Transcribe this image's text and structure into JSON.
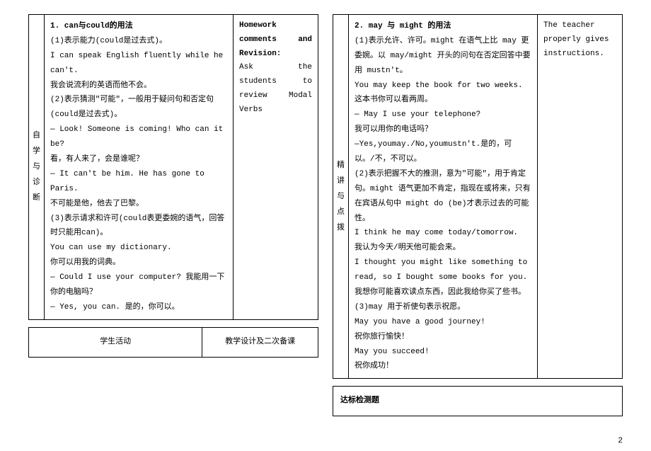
{
  "left": {
    "vlabel": [
      "自",
      "学",
      "与",
      "诊",
      "断"
    ],
    "heading": "1. can与could的用法",
    "lines": [
      "(1)表示能力(could是过去式)。",
      "I can speak English fluently while he can't.",
      "我会说流利的英语而他不会。",
      "(2)表示猜测\"可能\"，一般用于疑问句和否定句(could是过去式)。",
      "— Look! Someone is coming! Who can it be?",
      "看，有人来了，会是谁呢？",
      "— It can't be him. He has gone to Paris.",
      "不可能是他，他去了巴黎。",
      "(3)表示请求和许可(could表更委婉的语气，回答时只能用can)。",
      "You can use my dictionary.",
      "你可以用我的词典。",
      "— Could I use your computer?  我能用一下你的电脑吗？",
      "— Yes, you can. 是的，你可以。"
    ],
    "notes_heading": "Homework comments and Revision:",
    "notes_body": "Ask the students to review Modal Verbs",
    "bottom_left": "学生活动",
    "bottom_right": "教学设计及二次备课"
  },
  "right": {
    "vlabel": [
      "精",
      "讲",
      "与",
      "点",
      "拨"
    ],
    "heading": "2. may 与 might 的用法",
    "lines": [
      "(1)表示允许、许可。might 在语气上比 may 更委婉。以 may/might 开头的问句在否定回答中要用 mustn't。",
      "You may keep the book for two weeks.",
      "这本书你可以看两周。",
      "— May I use your telephone?",
      "我可以用你的电话吗？",
      "—Yes,youmay./No,youmustn't.是的，可以。/不，不可以。",
      "(2)表示把握不大的推测，意为\"可能\"，用于肯定句。might 语气更加不肯定，指现在或将来，只有在宾语从句中 might do (be)才表示过去的可能性。",
      "I think he may come today/tomorrow.",
      "我认为今天/明天他可能会来。",
      "I thought you might like something to read, so I bought some books for you.",
      "我想你可能喜欢读点东西，因此我给你买了些书。",
      "(3)may 用于祈使句表示祝愿。",
      "May you have a good journey!",
      "祝你旅行愉快！",
      "May you succeed!",
      "祝你成功！"
    ],
    "notes_lines": [
      "The teacher",
      "properly gives",
      "instructions."
    ],
    "bottom_title": "达标检测题"
  },
  "page_number": "2"
}
